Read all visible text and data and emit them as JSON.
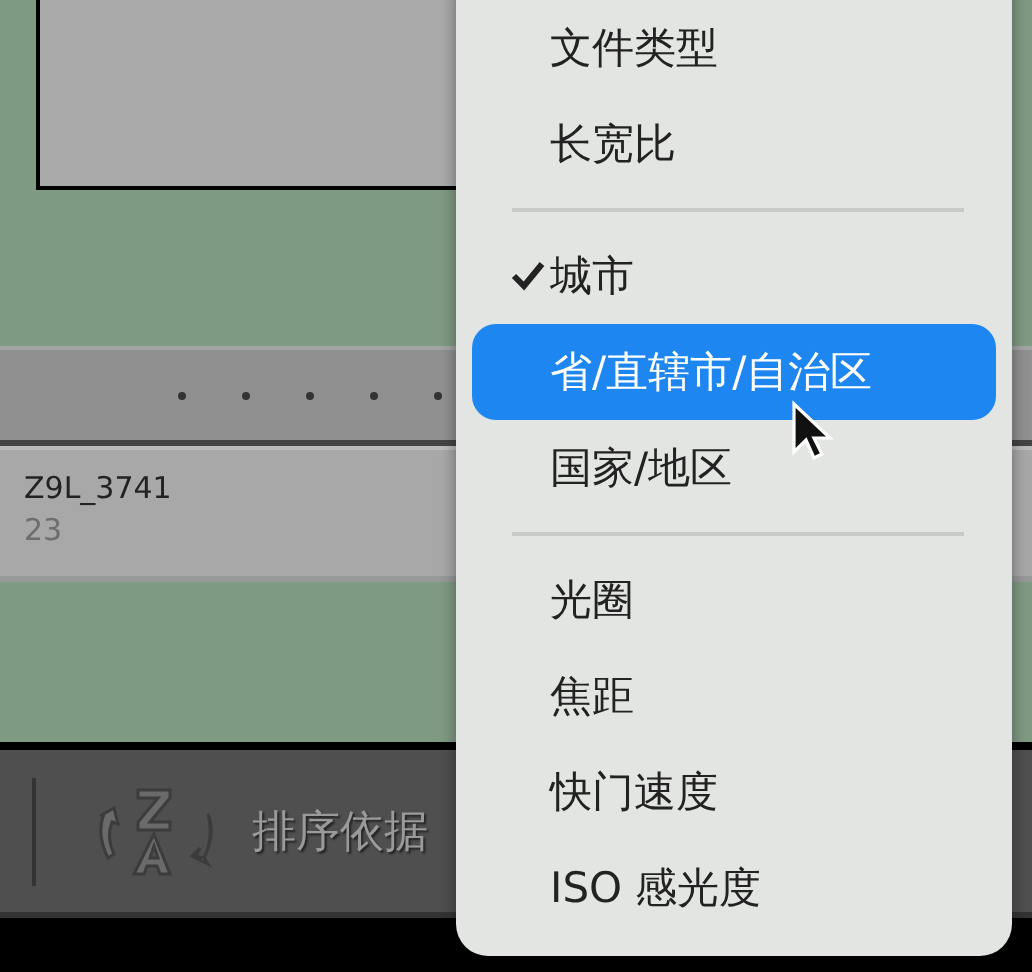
{
  "filmstrip": {
    "filename": "Z9L_3741",
    "index": "23"
  },
  "toolbar": {
    "sort_label": "排序依据"
  },
  "menu": {
    "items": [
      {
        "kind": "item",
        "label": "文件类型",
        "checked": false,
        "selected": false
      },
      {
        "kind": "item",
        "label": "长宽比",
        "checked": false,
        "selected": false
      },
      {
        "kind": "separator"
      },
      {
        "kind": "item",
        "label": "城市",
        "checked": true,
        "selected": false
      },
      {
        "kind": "item",
        "label": "省/直辖市/自治区",
        "checked": false,
        "selected": true
      },
      {
        "kind": "item",
        "label": "国家/地区",
        "checked": false,
        "selected": false
      },
      {
        "kind": "separator"
      },
      {
        "kind": "item",
        "label": "光圈",
        "checked": false,
        "selected": false
      },
      {
        "kind": "item",
        "label": "焦距",
        "checked": false,
        "selected": false
      },
      {
        "kind": "item",
        "label": "快门速度",
        "checked": false,
        "selected": false
      },
      {
        "kind": "item",
        "label": "ISO 感光度",
        "checked": false,
        "selected": false
      }
    ]
  }
}
